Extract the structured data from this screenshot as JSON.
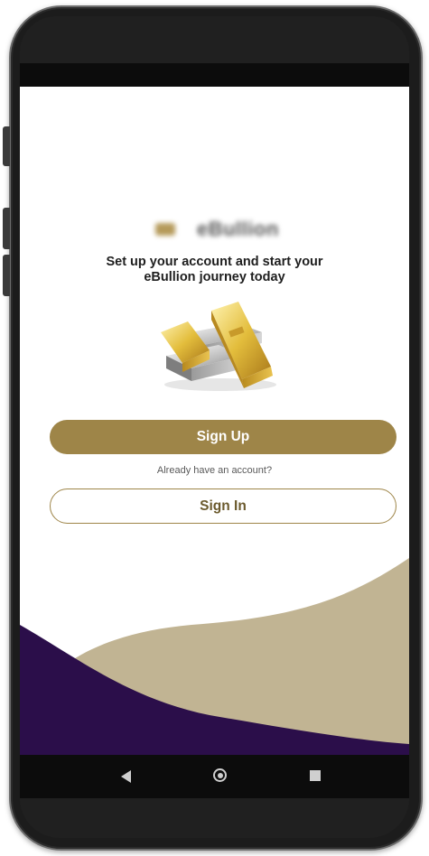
{
  "app": {
    "name": "eBullion",
    "tagline_line1": "Set up your account and start your",
    "tagline_line2": "eBullion journey today"
  },
  "buttons": {
    "signup_label": "Sign Up",
    "signin_label": "Sign In"
  },
  "text": {
    "already": "Already have an account?"
  },
  "nav": {
    "back": "back-triangle-icon",
    "home": "home-circle-icon",
    "recent": "recents-square-icon"
  },
  "colors": {
    "gold_accent": "#9e8548",
    "wave_tan": "#c1b493",
    "wave_purple": "#2b0e4a"
  }
}
